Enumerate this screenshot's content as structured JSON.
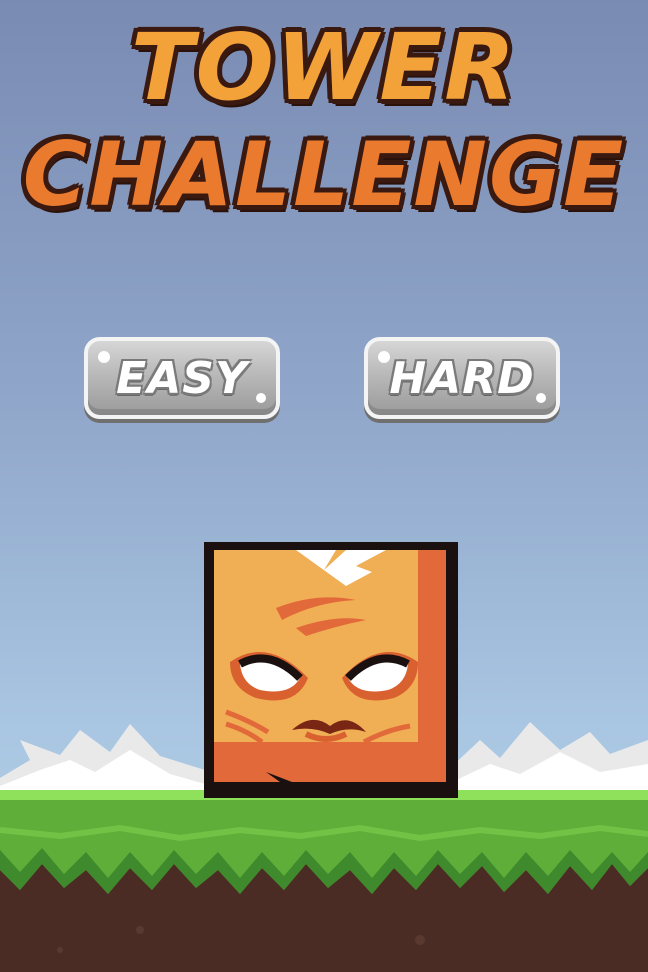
{
  "game": {
    "title_line_1": "TOWER",
    "title_line_2": "CHALLENGE"
  },
  "menu": {
    "easy_label": "EASY",
    "hard_label": "HARD"
  },
  "colors": {
    "sky_top": "#7a8bb3",
    "sky_bottom": "#b8d3ea",
    "title_orange": "#f0962f",
    "button_gray": "#b9b9b9",
    "grass": "#5fae3a",
    "dirt": "#4a2c24",
    "block_orange": "#f0ae55"
  },
  "icons": {
    "character": "angry-orange-block-icon"
  }
}
